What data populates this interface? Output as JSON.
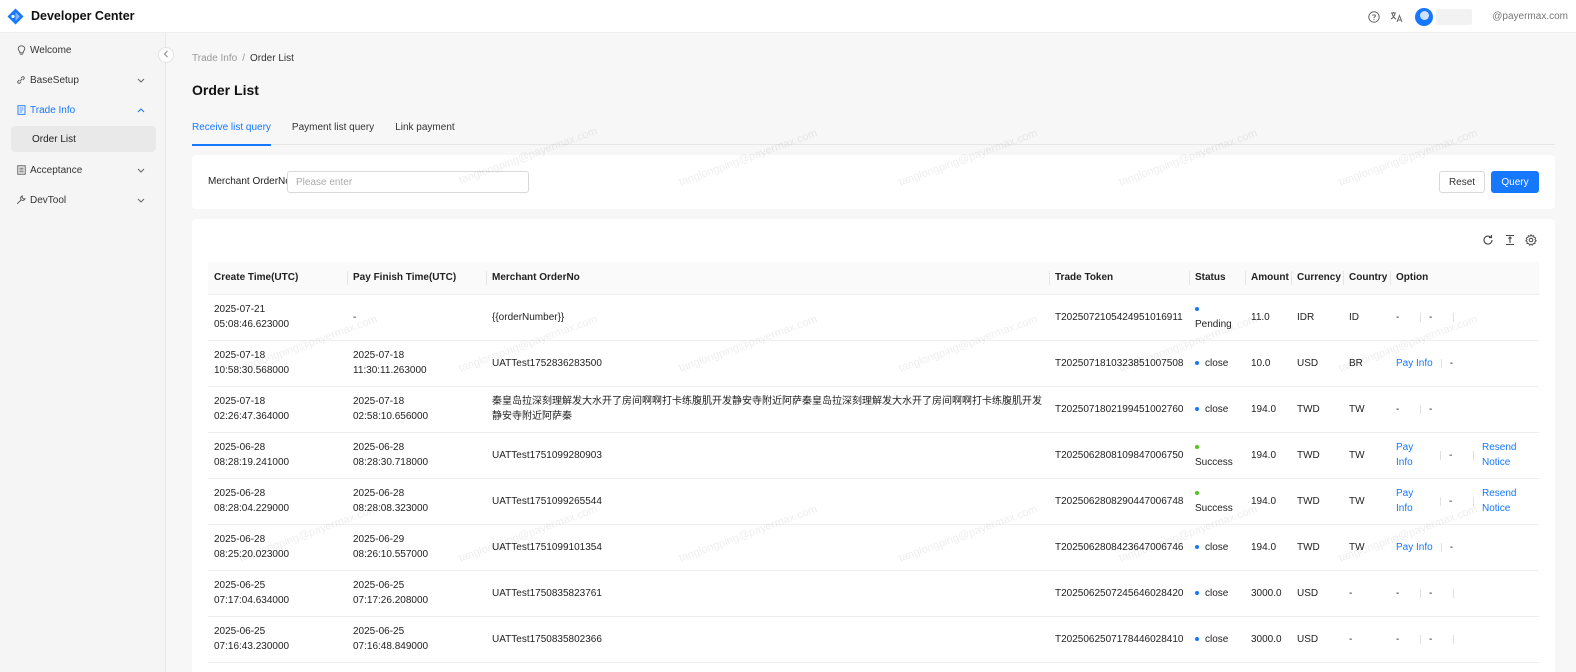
{
  "app": {
    "title": "Developer Center"
  },
  "header": {
    "user_email": "@payermax.com"
  },
  "sidebar": {
    "items": [
      {
        "label": "Welcome"
      },
      {
        "label": "BaseSetup"
      },
      {
        "label": "Trade Info"
      },
      {
        "label": "Acceptance"
      },
      {
        "label": "DevTool"
      }
    ],
    "sub_items": [
      {
        "label": "Order List"
      }
    ]
  },
  "breadcrumb": {
    "parent": "Trade Info",
    "separator": "/",
    "current": "Order List"
  },
  "page": {
    "title": "Order List"
  },
  "tabs": [
    {
      "label": "Receive list query"
    },
    {
      "label": "Payment list query"
    },
    {
      "label": "Link payment"
    }
  ],
  "filter": {
    "label": "Merchant OrderNo",
    "placeholder": "Please enter",
    "reset_label": "Reset",
    "query_label": "Query"
  },
  "table": {
    "columns": [
      "Create Time(UTC)",
      "Pay Finish Time(UTC)",
      "Merchant OrderNo",
      "Trade Token",
      "Status",
      "Amount",
      "Currency",
      "Country",
      "Option"
    ],
    "rows": [
      {
        "create": "2025-07-21 05:08:46.623000",
        "finish": "-",
        "order": "{{orderNumber}}",
        "token": "T2025072105424951016911",
        "status": "Pending",
        "amount": "11.0",
        "currency": "IDR",
        "country": "ID",
        "opt1": "-",
        "opt2": "-",
        "opt3": ""
      },
      {
        "create": "2025-07-18 10:58:30.568000",
        "finish": "2025-07-18 11:30:11.263000",
        "order": "UATTest1752836283500",
        "token": "T2025071810323851007508",
        "status": "close",
        "amount": "10.0",
        "currency": "USD",
        "country": "BR",
        "opt1": "Pay Info",
        "opt2": "-",
        "opt3": ""
      },
      {
        "create": "2025-07-18 02:26:47.364000",
        "finish": "2025-07-18 02:58:10.656000",
        "order": "秦皇岛拉深刻理解发大水开了房间啊啊打卡练腹肌开发静安寺附近阿萨秦皇岛拉深刻理解发大水开了房间啊啊打卡练腹肌开发静安寺附近阿萨秦",
        "token": "T2025071802199451002760",
        "status": "close",
        "amount": "194.0",
        "currency": "TWD",
        "country": "TW",
        "opt1": "-",
        "opt2": "-",
        "opt3": ""
      },
      {
        "create": "2025-06-28 08:28:19.241000",
        "finish": "2025-06-28 08:28:30.718000",
        "order": "UATTest1751099280903",
        "token": "T2025062808109847006750",
        "status": "Success",
        "amount": "194.0",
        "currency": "TWD",
        "country": "TW",
        "opt1": "Pay Info",
        "opt2": "-",
        "opt3": "Resend Notice"
      },
      {
        "create": "2025-06-28 08:28:04.229000",
        "finish": "2025-06-28 08:28:08.323000",
        "order": "UATTest1751099265544",
        "token": "T2025062808290447006748",
        "status": "Success",
        "amount": "194.0",
        "currency": "TWD",
        "country": "TW",
        "opt1": "Pay Info",
        "opt2": "-",
        "opt3": "Resend Notice"
      },
      {
        "create": "2025-06-28 08:25:20.023000",
        "finish": "2025-06-29 08:26:10.557000",
        "order": "UATTest1751099101354",
        "token": "T2025062808423647006746",
        "status": "close",
        "amount": "194.0",
        "currency": "TWD",
        "country": "TW",
        "opt1": "Pay Info",
        "opt2": "-",
        "opt3": ""
      },
      {
        "create": "2025-06-25 07:17:04.634000",
        "finish": "2025-06-25 07:17:26.208000",
        "order": "UATTest1750835823761",
        "token": "T2025062507245646028420",
        "status": "close",
        "amount": "3000.0",
        "currency": "USD",
        "country": "-",
        "opt1": "-",
        "opt2": "-",
        "opt3": ""
      },
      {
        "create": "2025-06-25 07:16:43.230000",
        "finish": "2025-06-25 07:16:48.849000",
        "order": "UATTest1750835802366",
        "token": "T2025062507178446028410",
        "status": "close",
        "amount": "3000.0",
        "currency": "USD",
        "country": "-",
        "opt1": "-",
        "opt2": "-",
        "opt3": ""
      }
    ]
  },
  "watermark": "tanglongping@payermax.com",
  "colors": {
    "accent": "#1677ff",
    "success": "#52c41a"
  }
}
